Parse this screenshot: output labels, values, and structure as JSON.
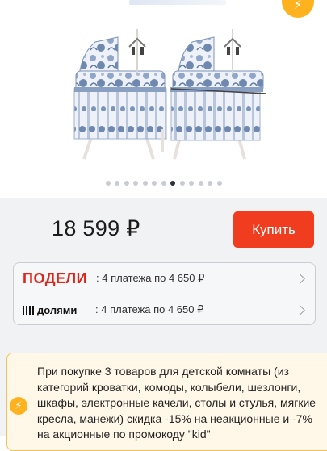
{
  "product": {
    "image_alt": "Колыбель",
    "gallery_dots": 13,
    "gallery_active_index": 7
  },
  "price": {
    "value": "18 599 ₽"
  },
  "buy_button": {
    "label": "Купить"
  },
  "payments": [
    {
      "brand": "ПОДЕЛИ",
      "text": ": 4 платежа по 4 650 ₽"
    },
    {
      "brand": "долями",
      "text": ": 4 платежа по 4 650 ₽"
    }
  ],
  "promo": {
    "text": "При покупке 3 товаров для детской комнаты (из категорий кроватки, комоды, колыбели, шезлонги, шкафы, электронные качели, столы и стулья, мягкие кресла, манежи) скидка -15% на неакционные и -7% на акционные по промокоду \"kid\""
  },
  "colors": {
    "accent": "#f03d1f",
    "podeli": "#e0251b",
    "promo_icon": "#ffb21e",
    "promo_border": "#f5c15a"
  },
  "icons": {
    "promo": "lightning-icon",
    "chevron": "chevron-right-icon"
  }
}
